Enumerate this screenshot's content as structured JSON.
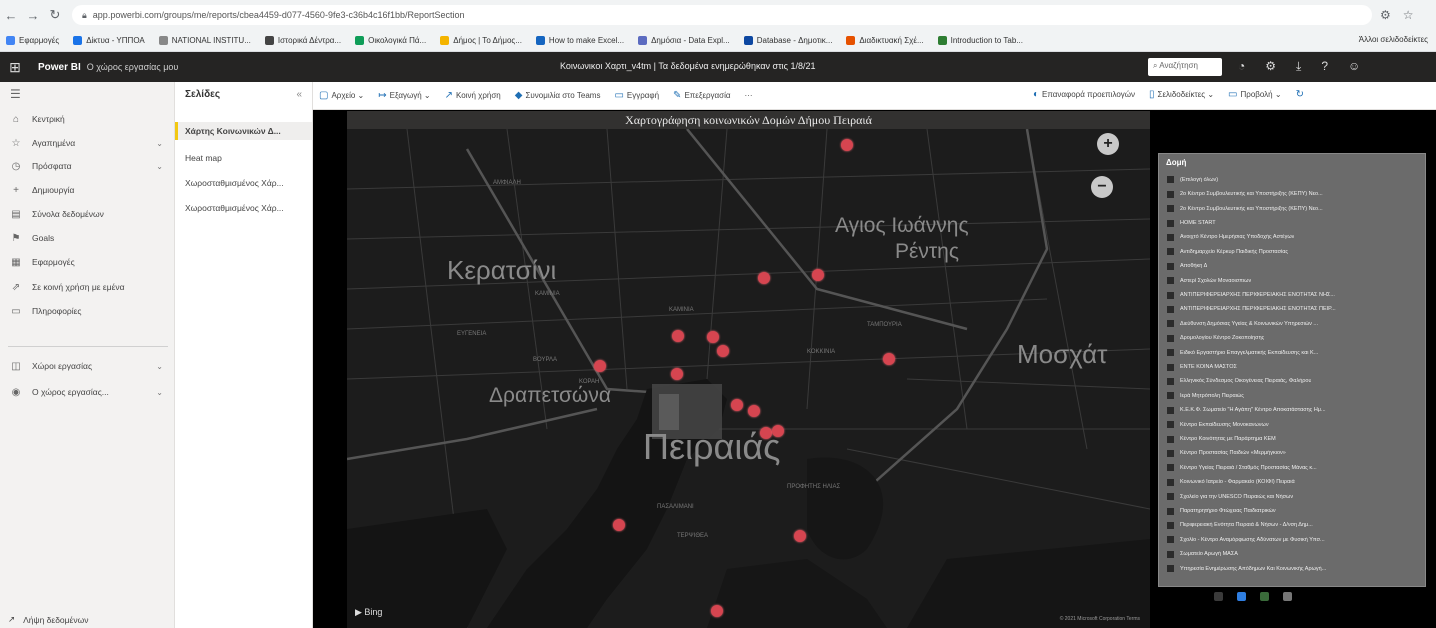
{
  "browser": {
    "url": "app.powerbi.com/groups/me/reports/cbea4459-d077-4560-9fe3-c36b4c16f1bb/ReportSection",
    "bookmarks": [
      "Εφαρμογές",
      "Δίκτυα - ΥΠΠΟΑ",
      "NATIONAL INSTITU...",
      "Ιστορικά Δέντρα...",
      "Οικολογικά Πά...",
      "Δήμος | Το Δήμος...",
      "How to make Excel...",
      "Δημόσια - Data Expl...",
      "Database - Δημοτικ...",
      "Διαδικτυακή Σχέ...",
      "Introduction to Tab..."
    ],
    "bookmarks_right": "Άλλοι σελιδοδείκτες"
  },
  "pbi": {
    "brand": "Power BI",
    "workspace": "Ο χώρος εργασίας μου",
    "report_title": "Κοινωνικοι Χαρτι_v4tm  |  Τα δεδομένα ενημερώθηκαν στις 1/8/21",
    "search_placeholder": "Αναζήτηση",
    "icons": [
      "bell-icon",
      "gear-icon",
      "download-icon",
      "help-icon",
      "smiley-icon"
    ]
  },
  "leftnav": {
    "items": [
      {
        "label": "Κεντρική",
        "icon": "⌂",
        "chevron": false
      },
      {
        "label": "Αγαπημένα",
        "icon": "☆",
        "chevron": true
      },
      {
        "label": "Πρόσφατα",
        "icon": "◷",
        "chevron": true
      },
      {
        "label": "Δημιουργία",
        "icon": "+",
        "chevron": false
      },
      {
        "label": "Σύνολα δεδομένων",
        "icon": "▤",
        "chevron": false
      },
      {
        "label": "Goals",
        "icon": "⚑",
        "chevron": false
      },
      {
        "label": "Εφαρμογές",
        "icon": "▦",
        "chevron": false
      },
      {
        "label": "Σε κοινή χρήση με εμένα",
        "icon": "⇗",
        "chevron": false
      },
      {
        "label": "Πληροφορίες",
        "icon": "▭",
        "chevron": false
      },
      {
        "label": "Χώροι εργασίας",
        "icon": "◫",
        "chevron": true
      },
      {
        "label": "Ο χώρος εργασίας...",
        "icon": "◉",
        "chevron": true
      }
    ],
    "bottom": "Λήψη δεδομένων"
  },
  "pages": {
    "header": "Σελίδες",
    "items": [
      "Χάρτης Κοινωνικών Δ...",
      "Heat map",
      "Χωροσταθμισμένος Χάρ...",
      "Χωροσταθμισμένος Χάρ..."
    ]
  },
  "toolbar": {
    "left": [
      {
        "icon": "▢",
        "label": "Αρχείο ⌄"
      },
      {
        "icon": "↦",
        "label": "Εξαγωγή ⌄"
      },
      {
        "icon": "↗",
        "label": "Κοινή χρήση"
      },
      {
        "icon": "◆",
        "label": "Συνομιλία στο Teams"
      },
      {
        "icon": "▭",
        "label": "Εγγραφή"
      },
      {
        "icon": "✎",
        "label": "Επεξεργασία"
      },
      {
        "icon": "",
        "label": "···"
      }
    ],
    "right": [
      {
        "icon": "◐",
        "label": "Επαναφορά προεπιλογών"
      },
      {
        "icon": "▯",
        "label": "Σελιδοδείκτες ⌄"
      },
      {
        "icon": "▭",
        "label": "Προβολή ⌄"
      },
      {
        "icon": "↻",
        "label": ""
      }
    ]
  },
  "map": {
    "title": "Χαρτογράφηση κοινωνικών Δομών Δήμου Πειραιά",
    "places": [
      {
        "label": "Κερατσίνι",
        "size": 26
      },
      {
        "label": "Αγιος Ιωάννης",
        "size": 21
      },
      {
        "label": "Ρέντης",
        "size": 21
      },
      {
        "label": "Μοσχάτ",
        "size": 26
      },
      {
        "label": "Δραπετσώνα",
        "size": 21
      },
      {
        "label": "Πειραιάς",
        "size": 36
      }
    ],
    "small_places": [
      "ΑΜΦΙΑΛΗ",
      "ΚΑΜΙΝΙΑ",
      "ΕΥΓΕΝΕΙΑ",
      "ΚΑΜΙΝΙΑ",
      "ΤΑΜΠΟΥΡΙΑ",
      "ΚΟΚΚΙΝΙΑ",
      "ΒΟΥΡΛΑ",
      "ΚΟΡΑΗ",
      "ΠΡΟΦΗΤΗΣ ΗΛΙΑΣ",
      "ΠΑΣΑΛΙΜΑΝΙ",
      "ΤΕΡΨΙΘΕΑ"
    ],
    "points": [
      [
        500,
        16
      ],
      [
        417,
        149
      ],
      [
        471,
        146
      ],
      [
        331,
        207
      ],
      [
        366,
        208
      ],
      [
        376,
        222
      ],
      [
        253,
        237
      ],
      [
        330,
        245
      ],
      [
        542,
        230
      ],
      [
        390,
        276
      ],
      [
        407,
        282
      ],
      [
        419,
        304
      ],
      [
        431,
        302
      ],
      [
        272,
        396
      ],
      [
        453,
        407
      ],
      [
        370,
        482
      ]
    ],
    "bing": "Bing",
    "copyright": "© 2021 Microsoft Corporation  Terms"
  },
  "legend": {
    "header": "Δομή",
    "items": [
      "(Επιλογή όλων)",
      "2ο Κέντρο Συμβουλευτικής και Υποστήριξης (ΚΕΠΥ) Νεο...",
      "2ο Κέντρο Συμβουλευτικής και Υποστήριξης (ΚΕΠΥ) Νεο...",
      "HOME START",
      "Ανοιχτό Κέντρο Ημερήσιας Υποδοχής Αστέγων",
      "Αντιδημαρχείο Κέρκυρ Παιδικής Προστασίας",
      "Αποθήκη Δ",
      "Αστερί Σχολών Μοναοισπιων",
      "ΑΝΤΙΠΕΡΙΦΕΡΕΙΑΡΧΗΣ ΠΕΡΙΦΕΡΕΙΑΚΗΣ ΕΝΟΤΗΤΑΣ ΝΗΣ...",
      "ΑΝΤΙΠΕΡΙΦΕΡΕΙΑΡΧΗΣ ΠΕΡΙΦΕΡΕΙΑΚΗΣ ΕΝΟΤΗΤΑΣ ΠΕΙΡ...",
      "Διεύθυνση Δημόσιας Υγείας & Κοινωνικών Υπηρεσιών ...",
      "Δρομολογίου Κέντρο Ζοκοποίησης",
      "Ειδικό Εργαστήριο Επαγγελματικής Εκπαίδευσης και Κ...",
      "ΕΝΤΕ ΚΟΙΝΑ ΜΑΣΤΟΣ",
      "Ελληνικός Σύνδεσμος Οικογένειας Πειραιάς, Φαλήρου",
      "Ιερά Μητρόπολη Πειραιώς",
      "Κ.Ε.Κ.Φ. Σωματείο \"Η Αγάπη\" Κέντρο Αποκατάστασης Ημ...",
      "Κέντρο Εκπαίδευσης Μονοκανωνων",
      "Κέντρο Κοινότητας με Παράρτημα ΚΕΜ",
      "Κέντρο Προστασίας Παιδιών «Μερμήγκιον»",
      "Κέντρο Υγείας Πειραιά / Σταθμός Προστασίας Μάνας κ...",
      "Κοινωνικό Ιατρείο - Φαρμακείο (ΚΟΙΦΙ) Πειραιά",
      "Σχολείο για την UNESCO Πειραιώς και Νήσων",
      "Παρατηρητήριο Φτώχειας Παιδιατρικών",
      "Περιφερειακή Ενότητα Πειραιά & Νήσων - Δ/νση Δημ...",
      "Σχολίο - Κέντρο Αναμόρφωσης Αδύνατων με Φυσική Υπσ...",
      "Σωματείο Αρωγή ΜΑΣΑ",
      "Υπηρεσία Ενημέρωσης Απόδημων Και Κοινωνικής Αρωγή..."
    ]
  },
  "colors": {
    "point": "#d64550",
    "accent": "#f2c811",
    "header_bg": "#252423"
  }
}
